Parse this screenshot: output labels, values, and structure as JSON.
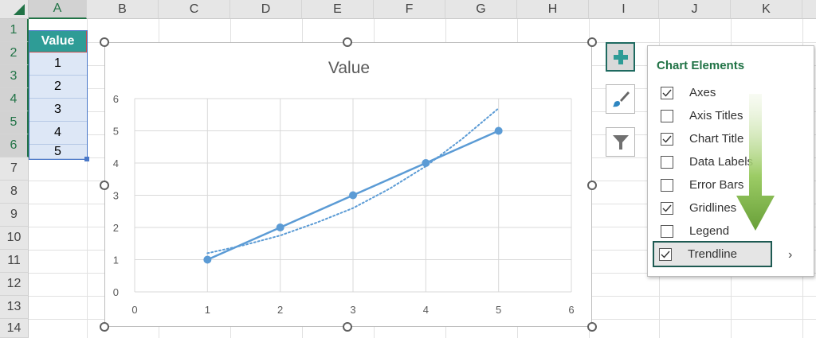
{
  "columns": [
    "A",
    "B",
    "C",
    "D",
    "E",
    "F",
    "G",
    "H",
    "I",
    "J",
    "K"
  ],
  "rows": [
    "1",
    "2",
    "3",
    "4",
    "5",
    "6",
    "7",
    "8",
    "9",
    "10",
    "11",
    "12",
    "13",
    "14"
  ],
  "cells": {
    "header": "Value",
    "values": [
      "1",
      "2",
      "3",
      "4",
      "5"
    ]
  },
  "chart_data": {
    "type": "scatter",
    "title": "Value",
    "xlabel": "",
    "ylabel": "",
    "xlim": [
      0,
      6
    ],
    "ylim": [
      0,
      6
    ],
    "x_ticks": [
      "0",
      "1",
      "2",
      "3",
      "4",
      "5",
      "6"
    ],
    "y_ticks": [
      "0",
      "1",
      "2",
      "3",
      "4",
      "5",
      "6"
    ],
    "grid": true,
    "legend": false,
    "series": [
      {
        "x": [
          1,
          2,
          3,
          4,
          5
        ],
        "y": [
          1,
          2,
          3,
          4,
          5
        ],
        "color": "#5b9bd5",
        "style": "line-markers"
      }
    ],
    "trendline": {
      "style": "dotted",
      "color": "#5b9bd5",
      "x": [
        1,
        1.5,
        2,
        2.5,
        3,
        3.5,
        4,
        4.5,
        5
      ],
      "y": [
        1.2,
        1.45,
        1.75,
        2.15,
        2.6,
        3.2,
        3.9,
        4.75,
        5.7
      ]
    }
  },
  "side_buttons": {
    "plus": "plus-icon",
    "brush": "brush-icon",
    "filter": "filter-icon"
  },
  "chart_elements": {
    "title": "Chart Elements",
    "options": [
      {
        "label": "Axes",
        "checked": true
      },
      {
        "label": "Axis Titles",
        "checked": false
      },
      {
        "label": "Chart Title",
        "checked": true
      },
      {
        "label": "Data Labels",
        "checked": false
      },
      {
        "label": "Error Bars",
        "checked": false
      },
      {
        "label": "Gridlines",
        "checked": true
      },
      {
        "label": "Legend",
        "checked": false
      },
      {
        "label": "Trendline",
        "checked": true
      }
    ],
    "more_arrow": "›"
  },
  "colors": {
    "accent_green": "#217346",
    "header_teal": "#2e9c96",
    "series_blue": "#5b9bd5",
    "arrow_green": "#7cb342"
  }
}
